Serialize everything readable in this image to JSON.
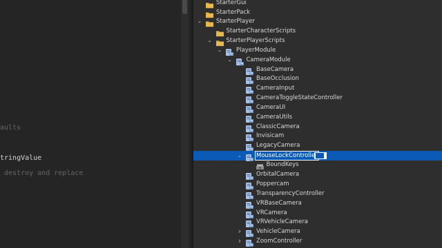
{
  "editor": {
    "lines": [
      {
        "text": "aults",
        "kind": "comment"
      },
      {
        "text": "tringValue",
        "kind": "text"
      },
      {
        "text": " destroy and replace",
        "kind": "comment"
      }
    ]
  },
  "explorer": {
    "items": [
      {
        "label": "StarterGui",
        "icon": "folder-icon",
        "expand": ""
      },
      {
        "label": "StarterPack",
        "icon": "folder-icon",
        "expand": ""
      },
      {
        "label": "StarterPlayer",
        "icon": "folder-icon",
        "expand": "expanded"
      },
      {
        "label": "StarterCharacterScripts",
        "icon": "folder-icon",
        "expand": ""
      },
      {
        "label": "StarterPlayerScripts",
        "icon": "folder-icon",
        "expand": "expanded"
      },
      {
        "label": "PlayerModule",
        "icon": "module-script-icon",
        "expand": "expanded"
      },
      {
        "label": "CameraModule",
        "icon": "module-script-icon",
        "expand": "expanded"
      },
      {
        "label": "BaseCamera",
        "icon": "module-script-icon",
        "expand": ""
      },
      {
        "label": "BaseOcclusion",
        "icon": "module-script-icon",
        "expand": ""
      },
      {
        "label": "CameraInput",
        "icon": "module-script-icon",
        "expand": ""
      },
      {
        "label": "CameraToggleStateController",
        "icon": "module-script-icon",
        "expand": ""
      },
      {
        "label": "CameraUI",
        "icon": "module-script-icon",
        "expand": ""
      },
      {
        "label": "CameraUtils",
        "icon": "module-script-icon",
        "expand": ""
      },
      {
        "label": "ClassicCamera",
        "icon": "module-script-icon",
        "expand": ""
      },
      {
        "label": "Invisicam",
        "icon": "module-script-icon",
        "expand": ""
      },
      {
        "label": "LegacyCamera",
        "icon": "module-script-icon",
        "expand": ""
      },
      {
        "label": "MouseLockController",
        "icon": "module-script-icon",
        "expand": "expanded",
        "selected": true
      },
      {
        "label": "BoundKeys",
        "icon": "bindable-keys-icon",
        "expand": ""
      },
      {
        "label": "OrbitalCamera",
        "icon": "module-script-icon",
        "expand": ""
      },
      {
        "label": "Poppercam",
        "icon": "module-script-icon",
        "expand": ""
      },
      {
        "label": "TransparencyController",
        "icon": "module-script-icon",
        "expand": ""
      },
      {
        "label": "VRBaseCamera",
        "icon": "module-script-icon",
        "expand": ""
      },
      {
        "label": "VRCamera",
        "icon": "module-script-icon",
        "expand": ""
      },
      {
        "label": "VRVehicleCamera",
        "icon": "module-script-icon",
        "expand": ""
      },
      {
        "label": "VehicleCamera",
        "icon": "module-script-icon",
        "expand": "collapsed"
      },
      {
        "label": "ZoomController",
        "icon": "module-script-icon",
        "expand": "collapsed"
      }
    ]
  },
  "colors": {
    "selection": "#0b5bb6",
    "folder": "#d9a43c",
    "module_script": "#a8c2e6"
  }
}
